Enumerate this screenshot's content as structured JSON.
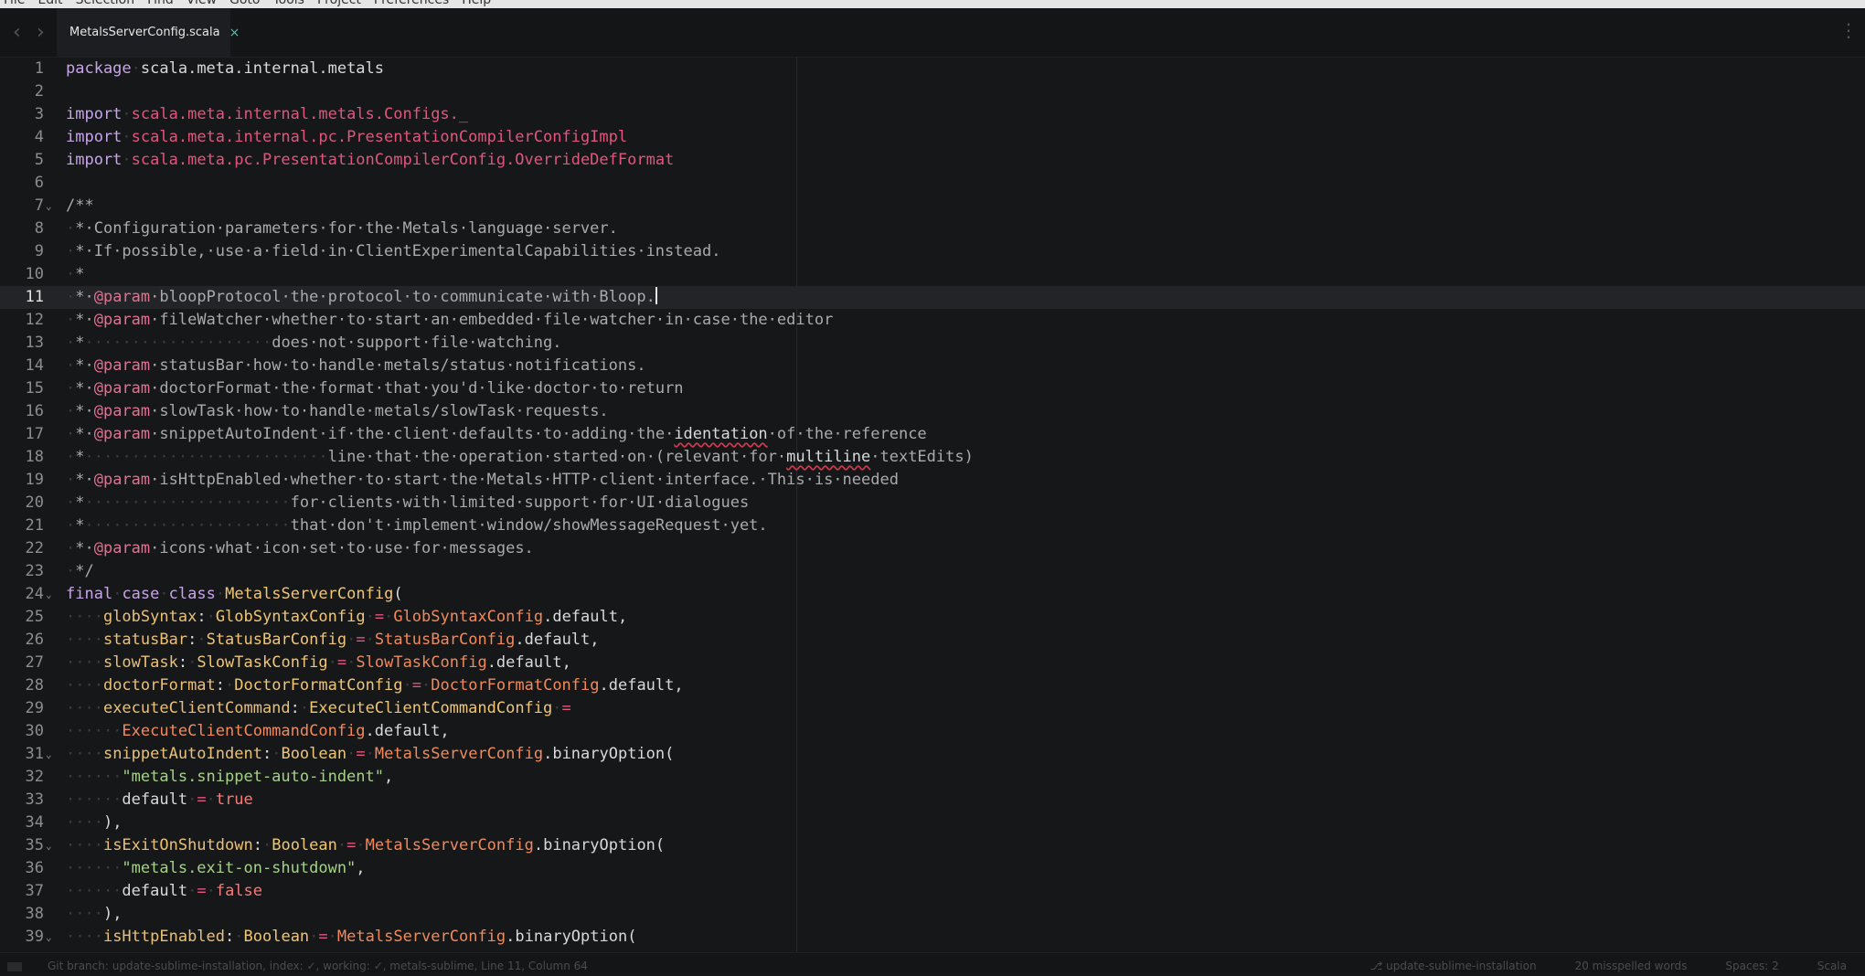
{
  "menubar": {
    "items": [
      "File",
      "Edit",
      "Selection",
      "Find",
      "View",
      "Goto",
      "Tools",
      "Project",
      "Preferences",
      "Help"
    ]
  },
  "tabs": [
    {
      "label": "MetalsServerConfig.scala",
      "close_icon": "×",
      "active": true
    }
  ],
  "navigation": {
    "back_icon": "‹",
    "forward_icon": "›",
    "menu_icon": "⋮"
  },
  "editor": {
    "active_line": 11,
    "lines": [
      {
        "n": "1",
        "fold": "",
        "parts": [
          [
            "kw",
            "package"
          ],
          [
            "ws",
            "·"
          ],
          [
            "nm",
            "scala.meta.internal.metals"
          ]
        ]
      },
      {
        "n": "2",
        "fold": "",
        "parts": []
      },
      {
        "n": "3",
        "fold": "",
        "parts": [
          [
            "kw",
            "import"
          ],
          [
            "ws",
            "·"
          ],
          [
            "imp",
            "scala.meta.internal.metals.Configs._"
          ]
        ]
      },
      {
        "n": "4",
        "fold": "",
        "parts": [
          [
            "kw",
            "import"
          ],
          [
            "ws",
            "·"
          ],
          [
            "imp",
            "scala.meta.internal.pc.PresentationCompilerConfigImpl"
          ]
        ]
      },
      {
        "n": "5",
        "fold": "",
        "parts": [
          [
            "kw",
            "import"
          ],
          [
            "ws",
            "·"
          ],
          [
            "imp",
            "scala.meta.pc.PresentationCompilerConfig.OverrideDefFormat"
          ]
        ]
      },
      {
        "n": "6",
        "fold": "",
        "parts": []
      },
      {
        "n": "7",
        "fold": "v",
        "parts": [
          [
            "cm",
            "/**"
          ]
        ]
      },
      {
        "n": "8",
        "fold": "",
        "parts": [
          [
            "ws",
            "·"
          ],
          [
            "cm",
            "*·Configuration·parameters·for·the·Metals·language·server."
          ]
        ]
      },
      {
        "n": "9",
        "fold": "",
        "parts": [
          [
            "ws",
            "·"
          ],
          [
            "cm",
            "*·If·possible,·use·a·field·in·ClientExperimentalCapabilities·instead."
          ]
        ]
      },
      {
        "n": "10",
        "fold": "",
        "parts": [
          [
            "ws",
            "·"
          ],
          [
            "cm",
            "*"
          ]
        ]
      },
      {
        "n": "11",
        "fold": "",
        "parts": [
          [
            "ws",
            "·"
          ],
          [
            "cm",
            "*·"
          ],
          [
            "at",
            "@param"
          ],
          [
            "cm",
            "·bloopProtocol·the·protocol·to·communicate·with·Bloop."
          ],
          [
            "cursor",
            ""
          ]
        ]
      },
      {
        "n": "12",
        "fold": "",
        "parts": [
          [
            "ws",
            "·"
          ],
          [
            "cm",
            "*·"
          ],
          [
            "at",
            "@param"
          ],
          [
            "cm",
            "·fileWatcher·whether·to·start·an·embedded·file·watcher·in·case·the·editor"
          ]
        ]
      },
      {
        "n": "13",
        "fold": "",
        "parts": [
          [
            "ws",
            "·"
          ],
          [
            "cm",
            "*"
          ],
          [
            "ws",
            "····················"
          ],
          [
            "cm",
            "does·not·support·file·watching."
          ]
        ]
      },
      {
        "n": "14",
        "fold": "",
        "parts": [
          [
            "ws",
            "·"
          ],
          [
            "cm",
            "*·"
          ],
          [
            "at",
            "@param"
          ],
          [
            "cm",
            "·statusBar·how·to·handle·metals/status·notifications."
          ]
        ]
      },
      {
        "n": "15",
        "fold": "",
        "parts": [
          [
            "ws",
            "·"
          ],
          [
            "cm",
            "*·"
          ],
          [
            "at",
            "@param"
          ],
          [
            "cm",
            "·doctorFormat·the·format·that·you'd·like·doctor·to·return"
          ]
        ]
      },
      {
        "n": "16",
        "fold": "",
        "parts": [
          [
            "ws",
            "·"
          ],
          [
            "cm",
            "*·"
          ],
          [
            "at",
            "@param"
          ],
          [
            "cm",
            "·slowTask·how·to·handle·metals/slowTask·requests."
          ]
        ]
      },
      {
        "n": "17",
        "fold": "",
        "parts": [
          [
            "ws",
            "·"
          ],
          [
            "cm",
            "*·"
          ],
          [
            "at",
            "@param"
          ],
          [
            "cm",
            "·snippetAutoIndent·if·the·client·defaults·to·adding·the·"
          ],
          [
            "sp",
            "identation"
          ],
          [
            "cm",
            "·of·the·reference"
          ]
        ]
      },
      {
        "n": "18",
        "fold": "",
        "parts": [
          [
            "ws",
            "·"
          ],
          [
            "cm",
            "*"
          ],
          [
            "ws",
            "··························"
          ],
          [
            "cm",
            "line·that·the·operation·started·on·(relevant·for·"
          ],
          [
            "sp",
            "multiline"
          ],
          [
            "cm",
            "·textEdits)"
          ]
        ]
      },
      {
        "n": "19",
        "fold": "",
        "parts": [
          [
            "ws",
            "·"
          ],
          [
            "cm",
            "*·"
          ],
          [
            "at",
            "@param"
          ],
          [
            "cm",
            "·isHttpEnabled·whether·to·start·the·Metals·HTTP·client·interface.·This·is·needed"
          ]
        ]
      },
      {
        "n": "20",
        "fold": "",
        "parts": [
          [
            "ws",
            "·"
          ],
          [
            "cm",
            "*"
          ],
          [
            "ws",
            "······················"
          ],
          [
            "cm",
            "for·clients·with·limited·support·for·UI·dialogues"
          ]
        ]
      },
      {
        "n": "21",
        "fold": "",
        "parts": [
          [
            "ws",
            "·"
          ],
          [
            "cm",
            "*"
          ],
          [
            "ws",
            "······················"
          ],
          [
            "cm",
            "that·don't·implement·window/showMessageRequest·yet."
          ]
        ]
      },
      {
        "n": "22",
        "fold": "",
        "parts": [
          [
            "ws",
            "·"
          ],
          [
            "cm",
            "*·"
          ],
          [
            "at",
            "@param"
          ],
          [
            "cm",
            "·icons·what·icon·set·to·use·for·messages."
          ]
        ]
      },
      {
        "n": "23",
        "fold": "",
        "parts": [
          [
            "ws",
            "·"
          ],
          [
            "cm",
            "*/"
          ]
        ]
      },
      {
        "n": "24",
        "fold": "v",
        "parts": [
          [
            "kw",
            "final"
          ],
          [
            "ws",
            "·"
          ],
          [
            "kw",
            "case"
          ],
          [
            "ws",
            "·"
          ],
          [
            "kw",
            "class"
          ],
          [
            "ws",
            "·"
          ],
          [
            "ty",
            "MetalsServerConfig"
          ],
          [
            "nm",
            "("
          ]
        ]
      },
      {
        "n": "25",
        "fold": "",
        "parts": [
          [
            "ws",
            "····"
          ],
          [
            "fn",
            "globSyntax"
          ],
          [
            "nm",
            ":"
          ],
          [
            "ws",
            "·"
          ],
          [
            "ty",
            "GlobSyntaxConfig"
          ],
          [
            "ws",
            "·"
          ],
          [
            "op",
            "="
          ],
          [
            "ws",
            "·"
          ],
          [
            "obj",
            "GlobSyntaxConfig"
          ],
          [
            "nm",
            ".default,"
          ]
        ]
      },
      {
        "n": "26",
        "fold": "",
        "parts": [
          [
            "ws",
            "····"
          ],
          [
            "fn",
            "statusBar"
          ],
          [
            "nm",
            ":"
          ],
          [
            "ws",
            "·"
          ],
          [
            "ty",
            "StatusBarConfig"
          ],
          [
            "ws",
            "·"
          ],
          [
            "op",
            "="
          ],
          [
            "ws",
            "·"
          ],
          [
            "obj",
            "StatusBarConfig"
          ],
          [
            "nm",
            ".default,"
          ]
        ]
      },
      {
        "n": "27",
        "fold": "",
        "parts": [
          [
            "ws",
            "····"
          ],
          [
            "fn",
            "slowTask"
          ],
          [
            "nm",
            ":"
          ],
          [
            "ws",
            "·"
          ],
          [
            "ty",
            "SlowTaskConfig"
          ],
          [
            "ws",
            "·"
          ],
          [
            "op",
            "="
          ],
          [
            "ws",
            "·"
          ],
          [
            "obj",
            "SlowTaskConfig"
          ],
          [
            "nm",
            ".default,"
          ]
        ]
      },
      {
        "n": "28",
        "fold": "",
        "parts": [
          [
            "ws",
            "····"
          ],
          [
            "fn",
            "doctorFormat"
          ],
          [
            "nm",
            ":"
          ],
          [
            "ws",
            "·"
          ],
          [
            "ty",
            "DoctorFormatConfig"
          ],
          [
            "ws",
            "·"
          ],
          [
            "op",
            "="
          ],
          [
            "ws",
            "·"
          ],
          [
            "obj",
            "DoctorFormatConfig"
          ],
          [
            "nm",
            ".default,"
          ]
        ]
      },
      {
        "n": "29",
        "fold": "",
        "parts": [
          [
            "ws",
            "····"
          ],
          [
            "fn",
            "executeClientCommand"
          ],
          [
            "nm",
            ":"
          ],
          [
            "ws",
            "·"
          ],
          [
            "ty",
            "ExecuteClientCommandConfig"
          ],
          [
            "ws",
            "·"
          ],
          [
            "op",
            "="
          ]
        ]
      },
      {
        "n": "30",
        "fold": "",
        "parts": [
          [
            "ws",
            "······"
          ],
          [
            "obj",
            "ExecuteClientCommandConfig"
          ],
          [
            "nm",
            ".default,"
          ]
        ]
      },
      {
        "n": "31",
        "fold": "v",
        "parts": [
          [
            "ws",
            "····"
          ],
          [
            "fn",
            "snippetAutoIndent"
          ],
          [
            "nm",
            ":"
          ],
          [
            "ws",
            "·"
          ],
          [
            "ty",
            "Boolean"
          ],
          [
            "ws",
            "·"
          ],
          [
            "op",
            "="
          ],
          [
            "ws",
            "·"
          ],
          [
            "obj",
            "MetalsServerConfig"
          ],
          [
            "nm",
            ".binaryOption("
          ]
        ]
      },
      {
        "n": "32",
        "fold": "",
        "parts": [
          [
            "ws",
            "······"
          ],
          [
            "st",
            "\"metals.snippet-auto-indent\""
          ],
          [
            "nm",
            ","
          ]
        ]
      },
      {
        "n": "33",
        "fold": "",
        "parts": [
          [
            "ws",
            "······"
          ],
          [
            "nm",
            "default"
          ],
          [
            "ws",
            "·"
          ],
          [
            "op",
            "="
          ],
          [
            "ws",
            "·"
          ],
          [
            "bo",
            "true"
          ]
        ]
      },
      {
        "n": "34",
        "fold": "",
        "parts": [
          [
            "ws",
            "····"
          ],
          [
            "nm",
            "),"
          ]
        ]
      },
      {
        "n": "35",
        "fold": "v",
        "parts": [
          [
            "ws",
            "····"
          ],
          [
            "fn",
            "isExitOnShutdown"
          ],
          [
            "nm",
            ":"
          ],
          [
            "ws",
            "·"
          ],
          [
            "ty",
            "Boolean"
          ],
          [
            "ws",
            "·"
          ],
          [
            "op",
            "="
          ],
          [
            "ws",
            "·"
          ],
          [
            "obj",
            "MetalsServerConfig"
          ],
          [
            "nm",
            ".binaryOption("
          ]
        ]
      },
      {
        "n": "36",
        "fold": "",
        "parts": [
          [
            "ws",
            "······"
          ],
          [
            "st",
            "\"metals.exit-on-shutdown\""
          ],
          [
            "nm",
            ","
          ]
        ]
      },
      {
        "n": "37",
        "fold": "",
        "parts": [
          [
            "ws",
            "······"
          ],
          [
            "nm",
            "default"
          ],
          [
            "ws",
            "·"
          ],
          [
            "op",
            "="
          ],
          [
            "ws",
            "·"
          ],
          [
            "bo",
            "false"
          ]
        ]
      },
      {
        "n": "38",
        "fold": "",
        "parts": [
          [
            "ws",
            "····"
          ],
          [
            "nm",
            "),"
          ]
        ]
      },
      {
        "n": "39",
        "fold": "v",
        "parts": [
          [
            "ws",
            "····"
          ],
          [
            "fn",
            "isHttpEnabled"
          ],
          [
            "nm",
            ":"
          ],
          [
            "ws",
            "·"
          ],
          [
            "ty",
            "Boolean"
          ],
          [
            "ws",
            "·"
          ],
          [
            "op",
            "="
          ],
          [
            "ws",
            "·"
          ],
          [
            "obj",
            "MetalsServerConfig"
          ],
          [
            "nm",
            ".binaryOption("
          ]
        ]
      }
    ]
  },
  "statusbar": {
    "left": "Git branch: update-sublime-installation, index: ✓, working: ✓, metals-sublime, Line 11, Column 64",
    "right": [
      "⎇ update-sublime-installation",
      "20 misspelled words",
      "Spaces: 2",
      "Scala"
    ]
  }
}
